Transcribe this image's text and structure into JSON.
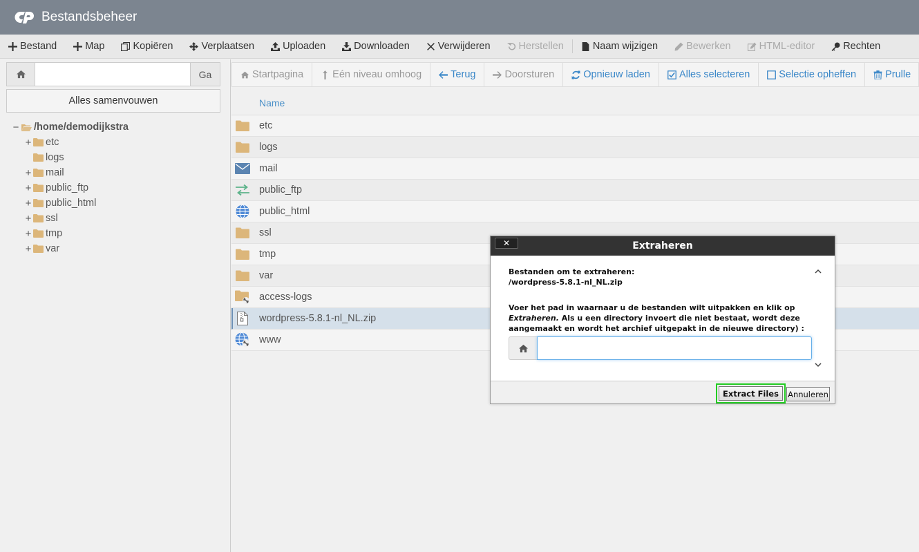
{
  "app": {
    "title": "Bestandsbeheer"
  },
  "toolbar": {
    "items": [
      {
        "label": "Bestand",
        "icon": "plus-icon",
        "enabled": true
      },
      {
        "label": "Map",
        "icon": "plus-icon",
        "enabled": true
      },
      {
        "label": "Kopiëren",
        "icon": "copy-icon",
        "enabled": true
      },
      {
        "label": "Verplaatsen",
        "icon": "move-icon",
        "enabled": true
      },
      {
        "label": "Uploaden",
        "icon": "upload-icon",
        "enabled": true
      },
      {
        "label": "Downloaden",
        "icon": "download-icon",
        "enabled": true
      },
      {
        "label": "Verwijderen",
        "icon": "close-icon",
        "enabled": true
      },
      {
        "label": "Herstellen",
        "icon": "undo-icon",
        "enabled": false
      },
      {
        "label": "Naam wijzigen",
        "icon": "file-icon",
        "enabled": true
      },
      {
        "label": "Bewerken",
        "icon": "pencil-icon",
        "enabled": false
      },
      {
        "label": "HTML-editor",
        "icon": "edit-icon",
        "enabled": false
      },
      {
        "label": "Rechten",
        "icon": "key-icon",
        "enabled": true
      }
    ]
  },
  "left": {
    "path_value": "",
    "go_label": "Ga",
    "collapse_label": "Alles samenvouwen",
    "tree_root": "/home/demodijkstra",
    "tree": [
      {
        "label": "etc",
        "expandable": true
      },
      {
        "label": "logs",
        "expandable": false
      },
      {
        "label": "mail",
        "expandable": true
      },
      {
        "label": "public_ftp",
        "expandable": true
      },
      {
        "label": "public_html",
        "expandable": true
      },
      {
        "label": "ssl",
        "expandable": true
      },
      {
        "label": "tmp",
        "expandable": true
      },
      {
        "label": "var",
        "expandable": true
      }
    ]
  },
  "nav": {
    "items": [
      {
        "label": "Startpagina",
        "icon": "home-icon",
        "enabled": false
      },
      {
        "label": "Eén niveau omhoog",
        "icon": "level-up-icon",
        "enabled": false
      },
      {
        "label": "Terug",
        "icon": "arrow-left-icon",
        "enabled": true
      },
      {
        "label": "Doorsturen",
        "icon": "arrow-right-icon",
        "enabled": false
      },
      {
        "label": "Opnieuw laden",
        "icon": "refresh-icon",
        "enabled": true
      },
      {
        "label": "Alles selecteren",
        "icon": "checkbox-checked-icon",
        "enabled": true
      },
      {
        "label": "Selectie opheffen",
        "icon": "checkbox-icon",
        "enabled": true
      },
      {
        "label": "Prulle",
        "icon": "trash-icon",
        "enabled": true
      }
    ]
  },
  "files": {
    "column_name": "Name",
    "rows": [
      {
        "name": "etc",
        "icon": "folder-icon"
      },
      {
        "name": "logs",
        "icon": "folder-icon"
      },
      {
        "name": "mail",
        "icon": "mail-icon"
      },
      {
        "name": "public_ftp",
        "icon": "transfer-icon"
      },
      {
        "name": "public_html",
        "icon": "globe-icon"
      },
      {
        "name": "ssl",
        "icon": "folder-icon"
      },
      {
        "name": "tmp",
        "icon": "folder-icon"
      },
      {
        "name": "var",
        "icon": "folder-icon"
      },
      {
        "name": "access-logs",
        "icon": "folder-link-icon"
      },
      {
        "name": "wordpress-5.8.1-nl_NL.zip",
        "icon": "zip-icon",
        "selected": true
      },
      {
        "name": "www",
        "icon": "globe-link-icon"
      }
    ]
  },
  "dialog": {
    "title": "Extraheren",
    "close_label": "✕",
    "files_label": "Bestanden om te extraheren:",
    "file_path": "/wordpress-5.8.1-nl_NL.zip",
    "instruction_before": "Voer het pad in waarnaar u de bestanden wilt uitpakken en klik op ",
    "instruction_em": "Extraheren.",
    "instruction_after": " Als u een directory invoert die niet bestaat, wordt deze aangemaakt en wordt het archief uitgepakt in de nieuwe directory) :",
    "extract_path_value": "",
    "extract_button": "Extract Files",
    "cancel_button": "Annuleren"
  },
  "colors": {
    "header_bg": "#7c8590",
    "link_blue": "#3a87c8",
    "folder": "#dcb67a",
    "highlight_green": "#22cc22"
  }
}
